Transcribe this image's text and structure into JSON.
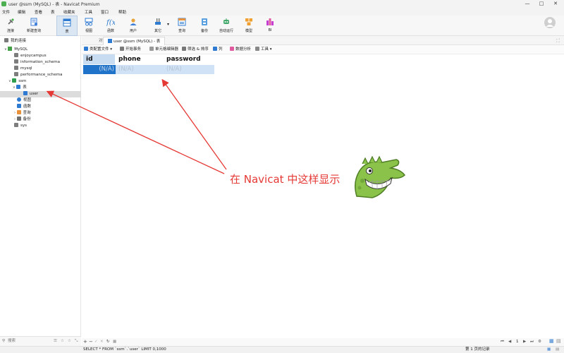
{
  "window": {
    "title": "user @ssm (MySQL) - 表 - Navicat Premium",
    "min": "—",
    "max": "□",
    "close": "✕"
  },
  "menu": [
    "文件",
    "编辑",
    "查看",
    "表",
    "收藏夹",
    "工具",
    "窗口",
    "帮助"
  ],
  "toolbar": {
    "items": [
      {
        "label": "连接",
        "icon": "plug-icon",
        "color": "#6a6a6a"
      },
      {
        "label": "新建查询",
        "icon": "new-query-icon",
        "color": "#3b7dd8"
      },
      {
        "label": "表",
        "icon": "table-icon",
        "color": "#2f7bd1",
        "active": true
      },
      {
        "label": "视图",
        "icon": "view-icon",
        "color": "#2f7bd1"
      },
      {
        "label": "函数",
        "icon": "function-icon",
        "color": "#2f7bd1"
      },
      {
        "label": "用户",
        "icon": "user-icon",
        "color": "#e8a23a"
      },
      {
        "label": "其它",
        "icon": "tools-icon",
        "color": "#2f7bd1"
      },
      {
        "label": "查询",
        "icon": "query-icon",
        "color": "#2f7bd1"
      },
      {
        "label": "备份",
        "icon": "backup-icon",
        "color": "#5aa0e0"
      },
      {
        "label": "自动运行",
        "icon": "robot-icon",
        "color": "#43a86b"
      },
      {
        "label": "模型",
        "icon": "model-icon",
        "color": "#f0a030"
      },
      {
        "label": "BI",
        "icon": "bi-icon",
        "color": "#c63fd0"
      }
    ],
    "other_dropdown": "▾"
  },
  "tree": {
    "root": "我的连接",
    "connection": "MySQL",
    "databases": [
      "enjoycampus",
      "information_schema",
      "mysql",
      "performance_schema",
      "ssm",
      "sys"
    ],
    "ssm_children": {
      "tables_label": "表",
      "selected_table": "user",
      "views": "视图",
      "functions": "函数",
      "queries": "查询",
      "backups": "备份"
    }
  },
  "tabs": {
    "objects": "对象",
    "current": "user @ssm (MySQL) - 表"
  },
  "gridbar": {
    "config": "类配置文件 ▾",
    "begin_tx": "开始事务",
    "memo": "单元格编辑器",
    "filter": "筛选 & 排序",
    "columns": "列",
    "profile": "数据分析",
    "tools": "工具 ▾"
  },
  "grid": {
    "columns": [
      "id",
      "phone",
      "password"
    ],
    "rows": [
      [
        "(N/A)",
        "(N/A)",
        "(N/A)"
      ]
    ]
  },
  "annotation": {
    "text": "在 Navicat 中这样显示",
    "color": "#e53935"
  },
  "search": {
    "placeholder": "搜索"
  },
  "footer": {
    "sql": "SELECT * FROM `ssm`.`user` LIMIT 0,1000",
    "page": "1",
    "records": "第 1 页的记录"
  }
}
